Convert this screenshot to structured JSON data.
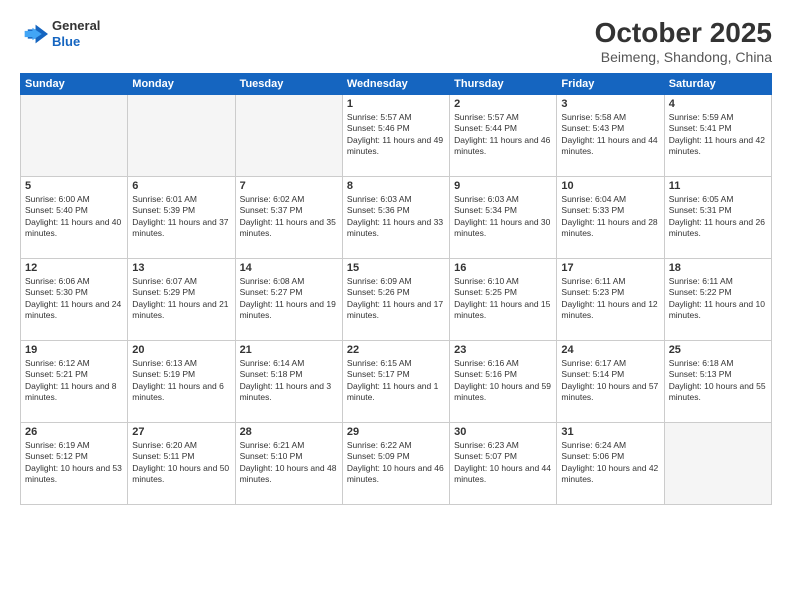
{
  "logo": {
    "general": "General",
    "blue": "Blue"
  },
  "title": "October 2025",
  "subtitle": "Beimeng, Shandong, China",
  "days_header": [
    "Sunday",
    "Monday",
    "Tuesday",
    "Wednesday",
    "Thursday",
    "Friday",
    "Saturday"
  ],
  "weeks": [
    [
      {
        "day": "",
        "info": ""
      },
      {
        "day": "",
        "info": ""
      },
      {
        "day": "",
        "info": ""
      },
      {
        "day": "1",
        "info": "Sunrise: 5:57 AM\nSunset: 5:46 PM\nDaylight: 11 hours and 49 minutes."
      },
      {
        "day": "2",
        "info": "Sunrise: 5:57 AM\nSunset: 5:44 PM\nDaylight: 11 hours and 46 minutes."
      },
      {
        "day": "3",
        "info": "Sunrise: 5:58 AM\nSunset: 5:43 PM\nDaylight: 11 hours and 44 minutes."
      },
      {
        "day": "4",
        "info": "Sunrise: 5:59 AM\nSunset: 5:41 PM\nDaylight: 11 hours and 42 minutes."
      }
    ],
    [
      {
        "day": "5",
        "info": "Sunrise: 6:00 AM\nSunset: 5:40 PM\nDaylight: 11 hours and 40 minutes."
      },
      {
        "day": "6",
        "info": "Sunrise: 6:01 AM\nSunset: 5:39 PM\nDaylight: 11 hours and 37 minutes."
      },
      {
        "day": "7",
        "info": "Sunrise: 6:02 AM\nSunset: 5:37 PM\nDaylight: 11 hours and 35 minutes."
      },
      {
        "day": "8",
        "info": "Sunrise: 6:03 AM\nSunset: 5:36 PM\nDaylight: 11 hours and 33 minutes."
      },
      {
        "day": "9",
        "info": "Sunrise: 6:03 AM\nSunset: 5:34 PM\nDaylight: 11 hours and 30 minutes."
      },
      {
        "day": "10",
        "info": "Sunrise: 6:04 AM\nSunset: 5:33 PM\nDaylight: 11 hours and 28 minutes."
      },
      {
        "day": "11",
        "info": "Sunrise: 6:05 AM\nSunset: 5:31 PM\nDaylight: 11 hours and 26 minutes."
      }
    ],
    [
      {
        "day": "12",
        "info": "Sunrise: 6:06 AM\nSunset: 5:30 PM\nDaylight: 11 hours and 24 minutes."
      },
      {
        "day": "13",
        "info": "Sunrise: 6:07 AM\nSunset: 5:29 PM\nDaylight: 11 hours and 21 minutes."
      },
      {
        "day": "14",
        "info": "Sunrise: 6:08 AM\nSunset: 5:27 PM\nDaylight: 11 hours and 19 minutes."
      },
      {
        "day": "15",
        "info": "Sunrise: 6:09 AM\nSunset: 5:26 PM\nDaylight: 11 hours and 17 minutes."
      },
      {
        "day": "16",
        "info": "Sunrise: 6:10 AM\nSunset: 5:25 PM\nDaylight: 11 hours and 15 minutes."
      },
      {
        "day": "17",
        "info": "Sunrise: 6:11 AM\nSunset: 5:23 PM\nDaylight: 11 hours and 12 minutes."
      },
      {
        "day": "18",
        "info": "Sunrise: 6:11 AM\nSunset: 5:22 PM\nDaylight: 11 hours and 10 minutes."
      }
    ],
    [
      {
        "day": "19",
        "info": "Sunrise: 6:12 AM\nSunset: 5:21 PM\nDaylight: 11 hours and 8 minutes."
      },
      {
        "day": "20",
        "info": "Sunrise: 6:13 AM\nSunset: 5:19 PM\nDaylight: 11 hours and 6 minutes."
      },
      {
        "day": "21",
        "info": "Sunrise: 6:14 AM\nSunset: 5:18 PM\nDaylight: 11 hours and 3 minutes."
      },
      {
        "day": "22",
        "info": "Sunrise: 6:15 AM\nSunset: 5:17 PM\nDaylight: 11 hours and 1 minute."
      },
      {
        "day": "23",
        "info": "Sunrise: 6:16 AM\nSunset: 5:16 PM\nDaylight: 10 hours and 59 minutes."
      },
      {
        "day": "24",
        "info": "Sunrise: 6:17 AM\nSunset: 5:14 PM\nDaylight: 10 hours and 57 minutes."
      },
      {
        "day": "25",
        "info": "Sunrise: 6:18 AM\nSunset: 5:13 PM\nDaylight: 10 hours and 55 minutes."
      }
    ],
    [
      {
        "day": "26",
        "info": "Sunrise: 6:19 AM\nSunset: 5:12 PM\nDaylight: 10 hours and 53 minutes."
      },
      {
        "day": "27",
        "info": "Sunrise: 6:20 AM\nSunset: 5:11 PM\nDaylight: 10 hours and 50 minutes."
      },
      {
        "day": "28",
        "info": "Sunrise: 6:21 AM\nSunset: 5:10 PM\nDaylight: 10 hours and 48 minutes."
      },
      {
        "day": "29",
        "info": "Sunrise: 6:22 AM\nSunset: 5:09 PM\nDaylight: 10 hours and 46 minutes."
      },
      {
        "day": "30",
        "info": "Sunrise: 6:23 AM\nSunset: 5:07 PM\nDaylight: 10 hours and 44 minutes."
      },
      {
        "day": "31",
        "info": "Sunrise: 6:24 AM\nSunset: 5:06 PM\nDaylight: 10 hours and 42 minutes."
      },
      {
        "day": "",
        "info": ""
      }
    ]
  ]
}
